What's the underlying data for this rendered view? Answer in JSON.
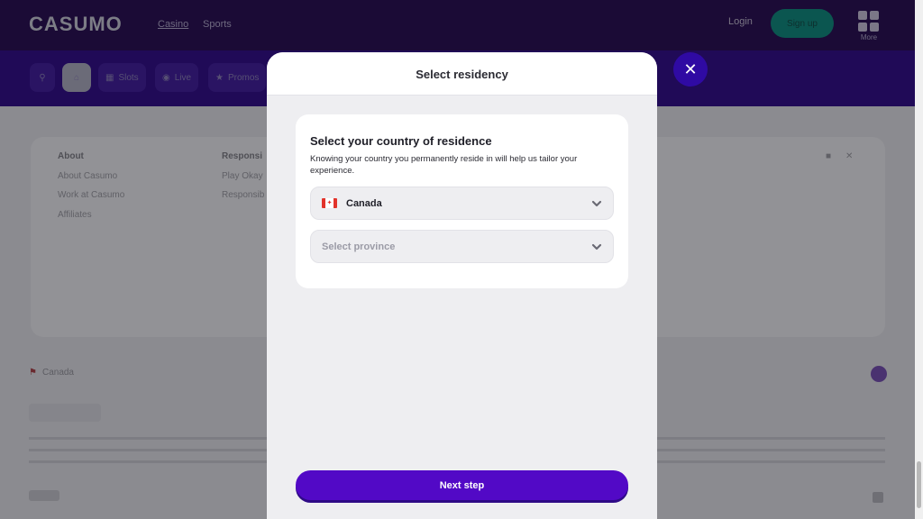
{
  "header": {
    "logo": "CASUMO",
    "nav": [
      {
        "label": "Casino"
      },
      {
        "label": "Sports"
      }
    ],
    "login_label": "Login",
    "signup_label": "Sign up",
    "more_label": "More"
  },
  "subnav": {
    "items": [
      {
        "label": "",
        "icon": "search-icon"
      },
      {
        "label": "",
        "icon": "home-icon"
      },
      {
        "label": "Slots",
        "icon": "slots-icon"
      },
      {
        "label": "Live",
        "icon": "live-icon"
      },
      {
        "label": "Promos",
        "icon": "promos-icon"
      }
    ]
  },
  "footer": {
    "about_heading": "About",
    "about_links": [
      "About Casumo",
      "Work at Casumo",
      "Affiliates"
    ],
    "responsible_heading": "Responsi",
    "responsible_links": [
      "Play Okay",
      "Responsib"
    ],
    "country": "Canada"
  },
  "modal": {
    "title": "Select residency",
    "card_title": "Select your country of residence",
    "card_description": "Knowing your country you permanently reside in will help us tailor your experience.",
    "country_value": "Canada",
    "province_placeholder": "Select province",
    "next_label": "Next step",
    "close_symbol": "✕"
  },
  "colors": {
    "brand_purple": "#5209c6",
    "close_purple": "#2f0aa3",
    "flag_red": "#e2332b"
  }
}
